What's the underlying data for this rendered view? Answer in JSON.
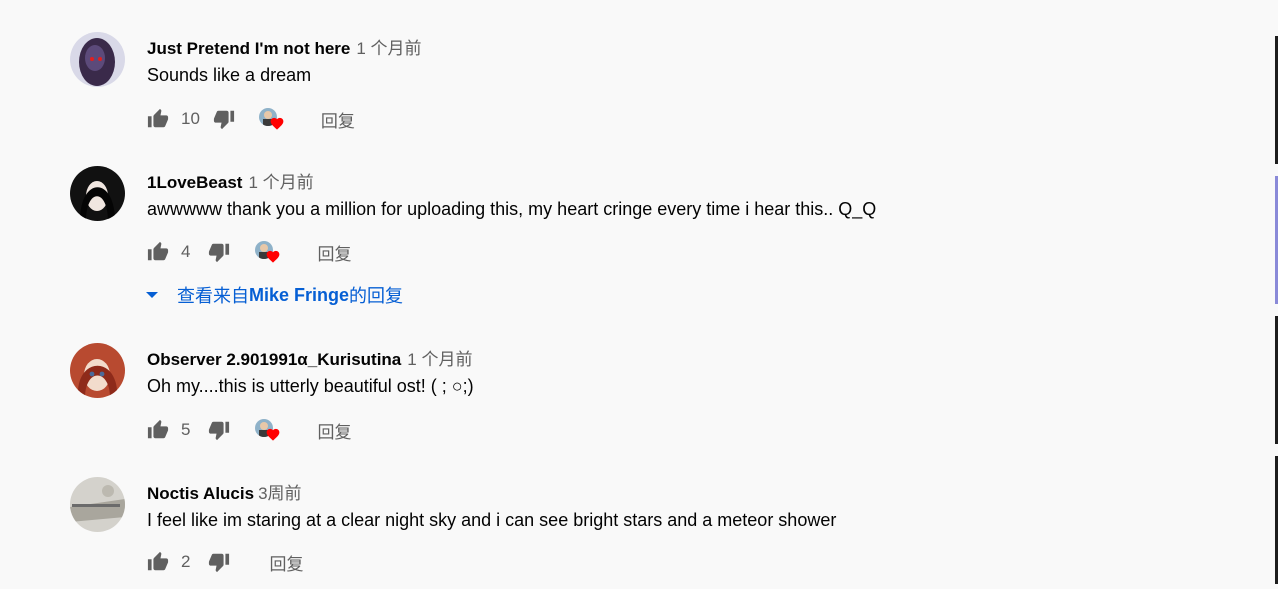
{
  "comments": [
    {
      "author": "Just Pretend I'm not here",
      "time": "1 个月前",
      "text": "Sounds like a dream",
      "likes": "10",
      "hearted": true,
      "reply_label": "回复"
    },
    {
      "author": "1LoveBeast",
      "time": "1 个月前",
      "text": "awwwww thank you a million for uploading this, my heart cringe every time i hear this.. Q_Q",
      "likes": "4",
      "hearted": true,
      "reply_label": "回复"
    },
    {
      "author": "Observer 2.901991α_Kurisutina",
      "time": "1 个月前",
      "text": "Oh my....this is utterly beautiful ost!  ( ; ○;)",
      "likes": "5",
      "hearted": true,
      "reply_label": "回复"
    },
    {
      "author": "Noctis Alucis",
      "time": "3周前",
      "text": "I feel like im staring at a clear night sky and i can see bright stars and  a meteor shower",
      "likes": "2",
      "hearted": false,
      "reply_label": "回复"
    }
  ],
  "view_replies": {
    "prefix": "查看来自",
    "name": "Mike Fringe",
    "suffix": "的回复"
  },
  "colors": {
    "link": "#065fd4",
    "heart": "#ff0000",
    "secondary_text": "#606060",
    "background": "#f9f9f9"
  },
  "icons": [
    "thumbs-up-icon",
    "thumbs-down-icon",
    "creator-heart-icon",
    "chevron-down-icon"
  ]
}
